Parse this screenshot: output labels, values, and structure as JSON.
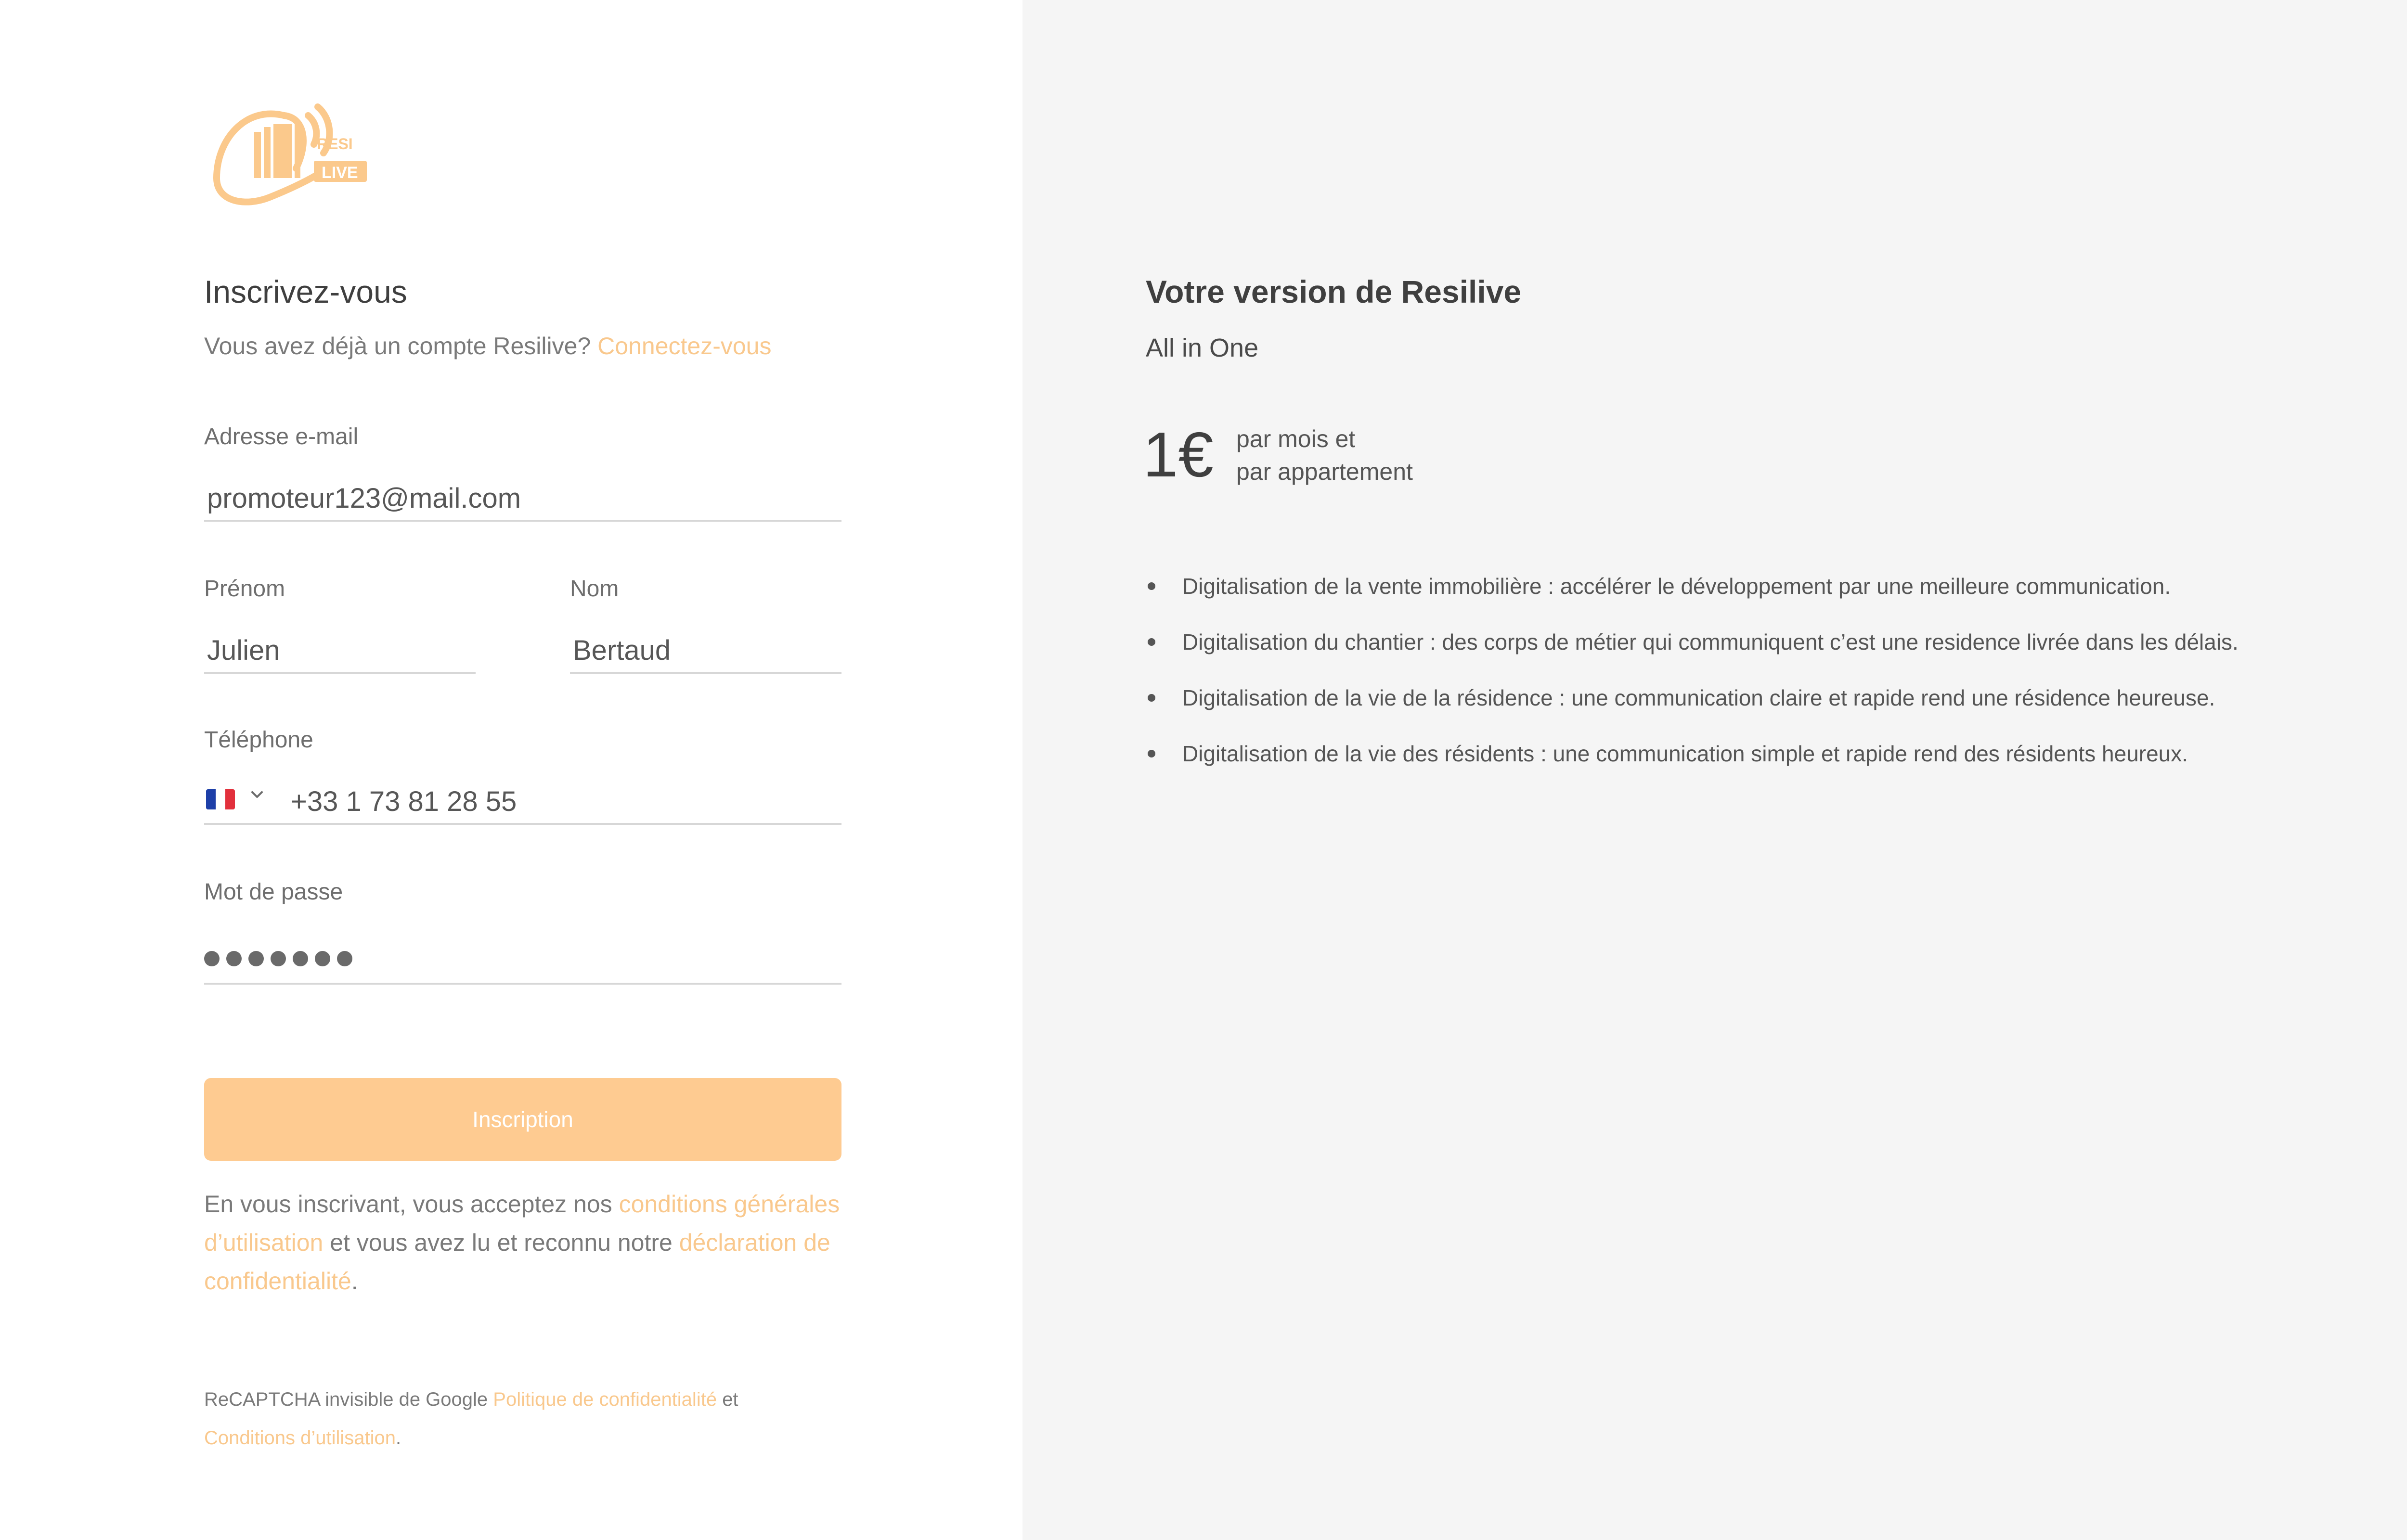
{
  "brand": {
    "logo_top": "RESI",
    "logo_bottom": "LIVE",
    "accent": "#fecb91",
    "link_color": "#f9c88d"
  },
  "signup": {
    "title": "Inscrivez-vous",
    "have_account": "Vous avez déjà un compte Resilive?",
    "login_link": "Connectez-vous",
    "email": {
      "label": "Adresse e-mail",
      "value": "promoteur123@mail.com"
    },
    "first_name": {
      "label": "Prénom",
      "value": "Julien"
    },
    "last_name": {
      "label": "Nom",
      "value": "Bertaud"
    },
    "phone": {
      "label": "Téléphone",
      "country_icon": "france-flag-icon",
      "value": "+33 1 73 81 28 55"
    },
    "password": {
      "label": "Mot de passe",
      "masked_length": 7
    },
    "submit_label": "Inscription",
    "terms": {
      "prefix": "En vous inscrivant, vous acceptez nos",
      "cgu_link": "conditions générales d’utilisation",
      "middle": "et vous avez lu et reconnu notre",
      "privacy_link": "déclaration de confidentialité",
      "suffix": "."
    },
    "recaptcha": {
      "prefix": "ReCAPTCHA invisible de Google",
      "privacy_link": "Politique de confidentialité",
      "middle": "et",
      "terms_link": "Conditions d’utilisation",
      "suffix": "."
    }
  },
  "plan": {
    "title": "Votre version de Resilive",
    "subtitle": "All in One",
    "price": "1€",
    "price_line1": "par mois et",
    "price_line2": "par appartement",
    "features": [
      "Digitalisation de la vente immobilière : accélérer le développement par une meilleure communication.",
      "Digitalisation du chantier : des corps de métier qui communiquent c’est une residence livrée dans les délais.",
      "Digitalisation de la vie de la résidence : une communication claire et rapide rend une résidence heureuse.",
      "Digitalisation de la vie des résidents : une communication simple et rapide rend des résidents heureux."
    ]
  }
}
